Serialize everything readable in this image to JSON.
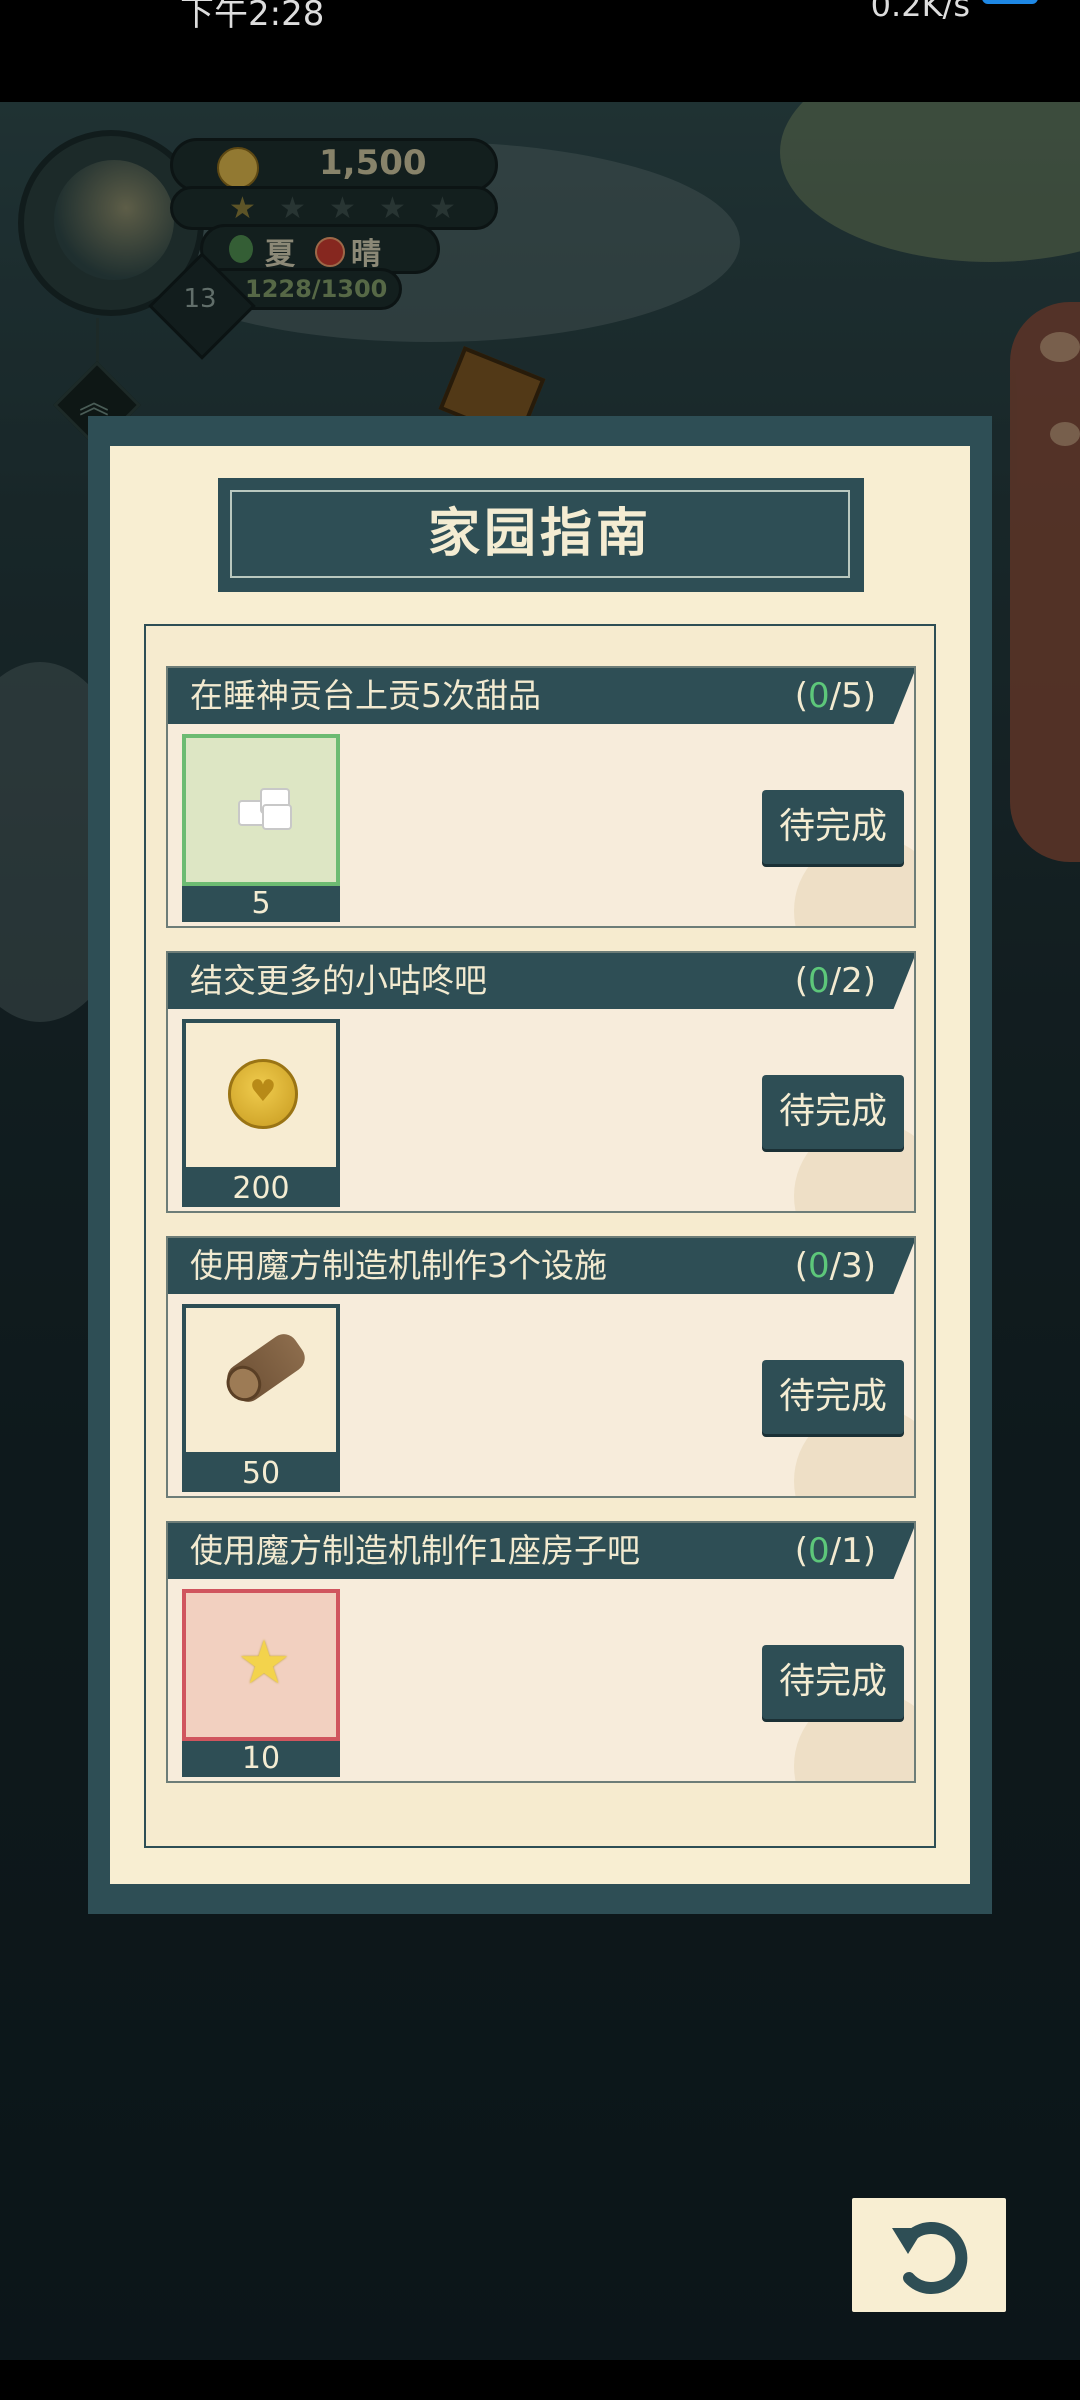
{
  "status_bar": {
    "time": "下午2:28",
    "right_text": "0.2K/s"
  },
  "hud": {
    "coins": "1,500",
    "season": "夏",
    "weather": "晴",
    "exp": "1228/1300",
    "level": "13",
    "stars_filled": 1,
    "stars_total": 5
  },
  "dialog": {
    "title": "家园指南",
    "tasks": [
      {
        "title": "在睡神贡台上贡5次甜品",
        "progress_open": "(",
        "progress_current": "0",
        "progress_total": "/5)",
        "reward_qty": "5",
        "reward_icon": "sugar-cube-icon",
        "status": "待完成"
      },
      {
        "title": "结交更多的小咕咚吧",
        "progress_open": "(",
        "progress_current": "0",
        "progress_total": "/2)",
        "reward_qty": "200",
        "reward_icon": "gold-coin-icon",
        "status": "待完成"
      },
      {
        "title": "使用魔方制造机制作3个设施",
        "progress_open": "(",
        "progress_current": "0",
        "progress_total": "/3)",
        "reward_qty": "50",
        "reward_icon": "wood-log-icon",
        "status": "待完成"
      },
      {
        "title": "使用魔方制造机制作1座房子吧",
        "progress_open": "(",
        "progress_current": "0",
        "progress_total": "/1)",
        "reward_qty": "10",
        "reward_icon": "star-icon",
        "status": "待完成"
      }
    ]
  },
  "colors": {
    "panel": "#f8eed2",
    "frame": "#2e4e55",
    "progress_current": "#5dc77a"
  }
}
